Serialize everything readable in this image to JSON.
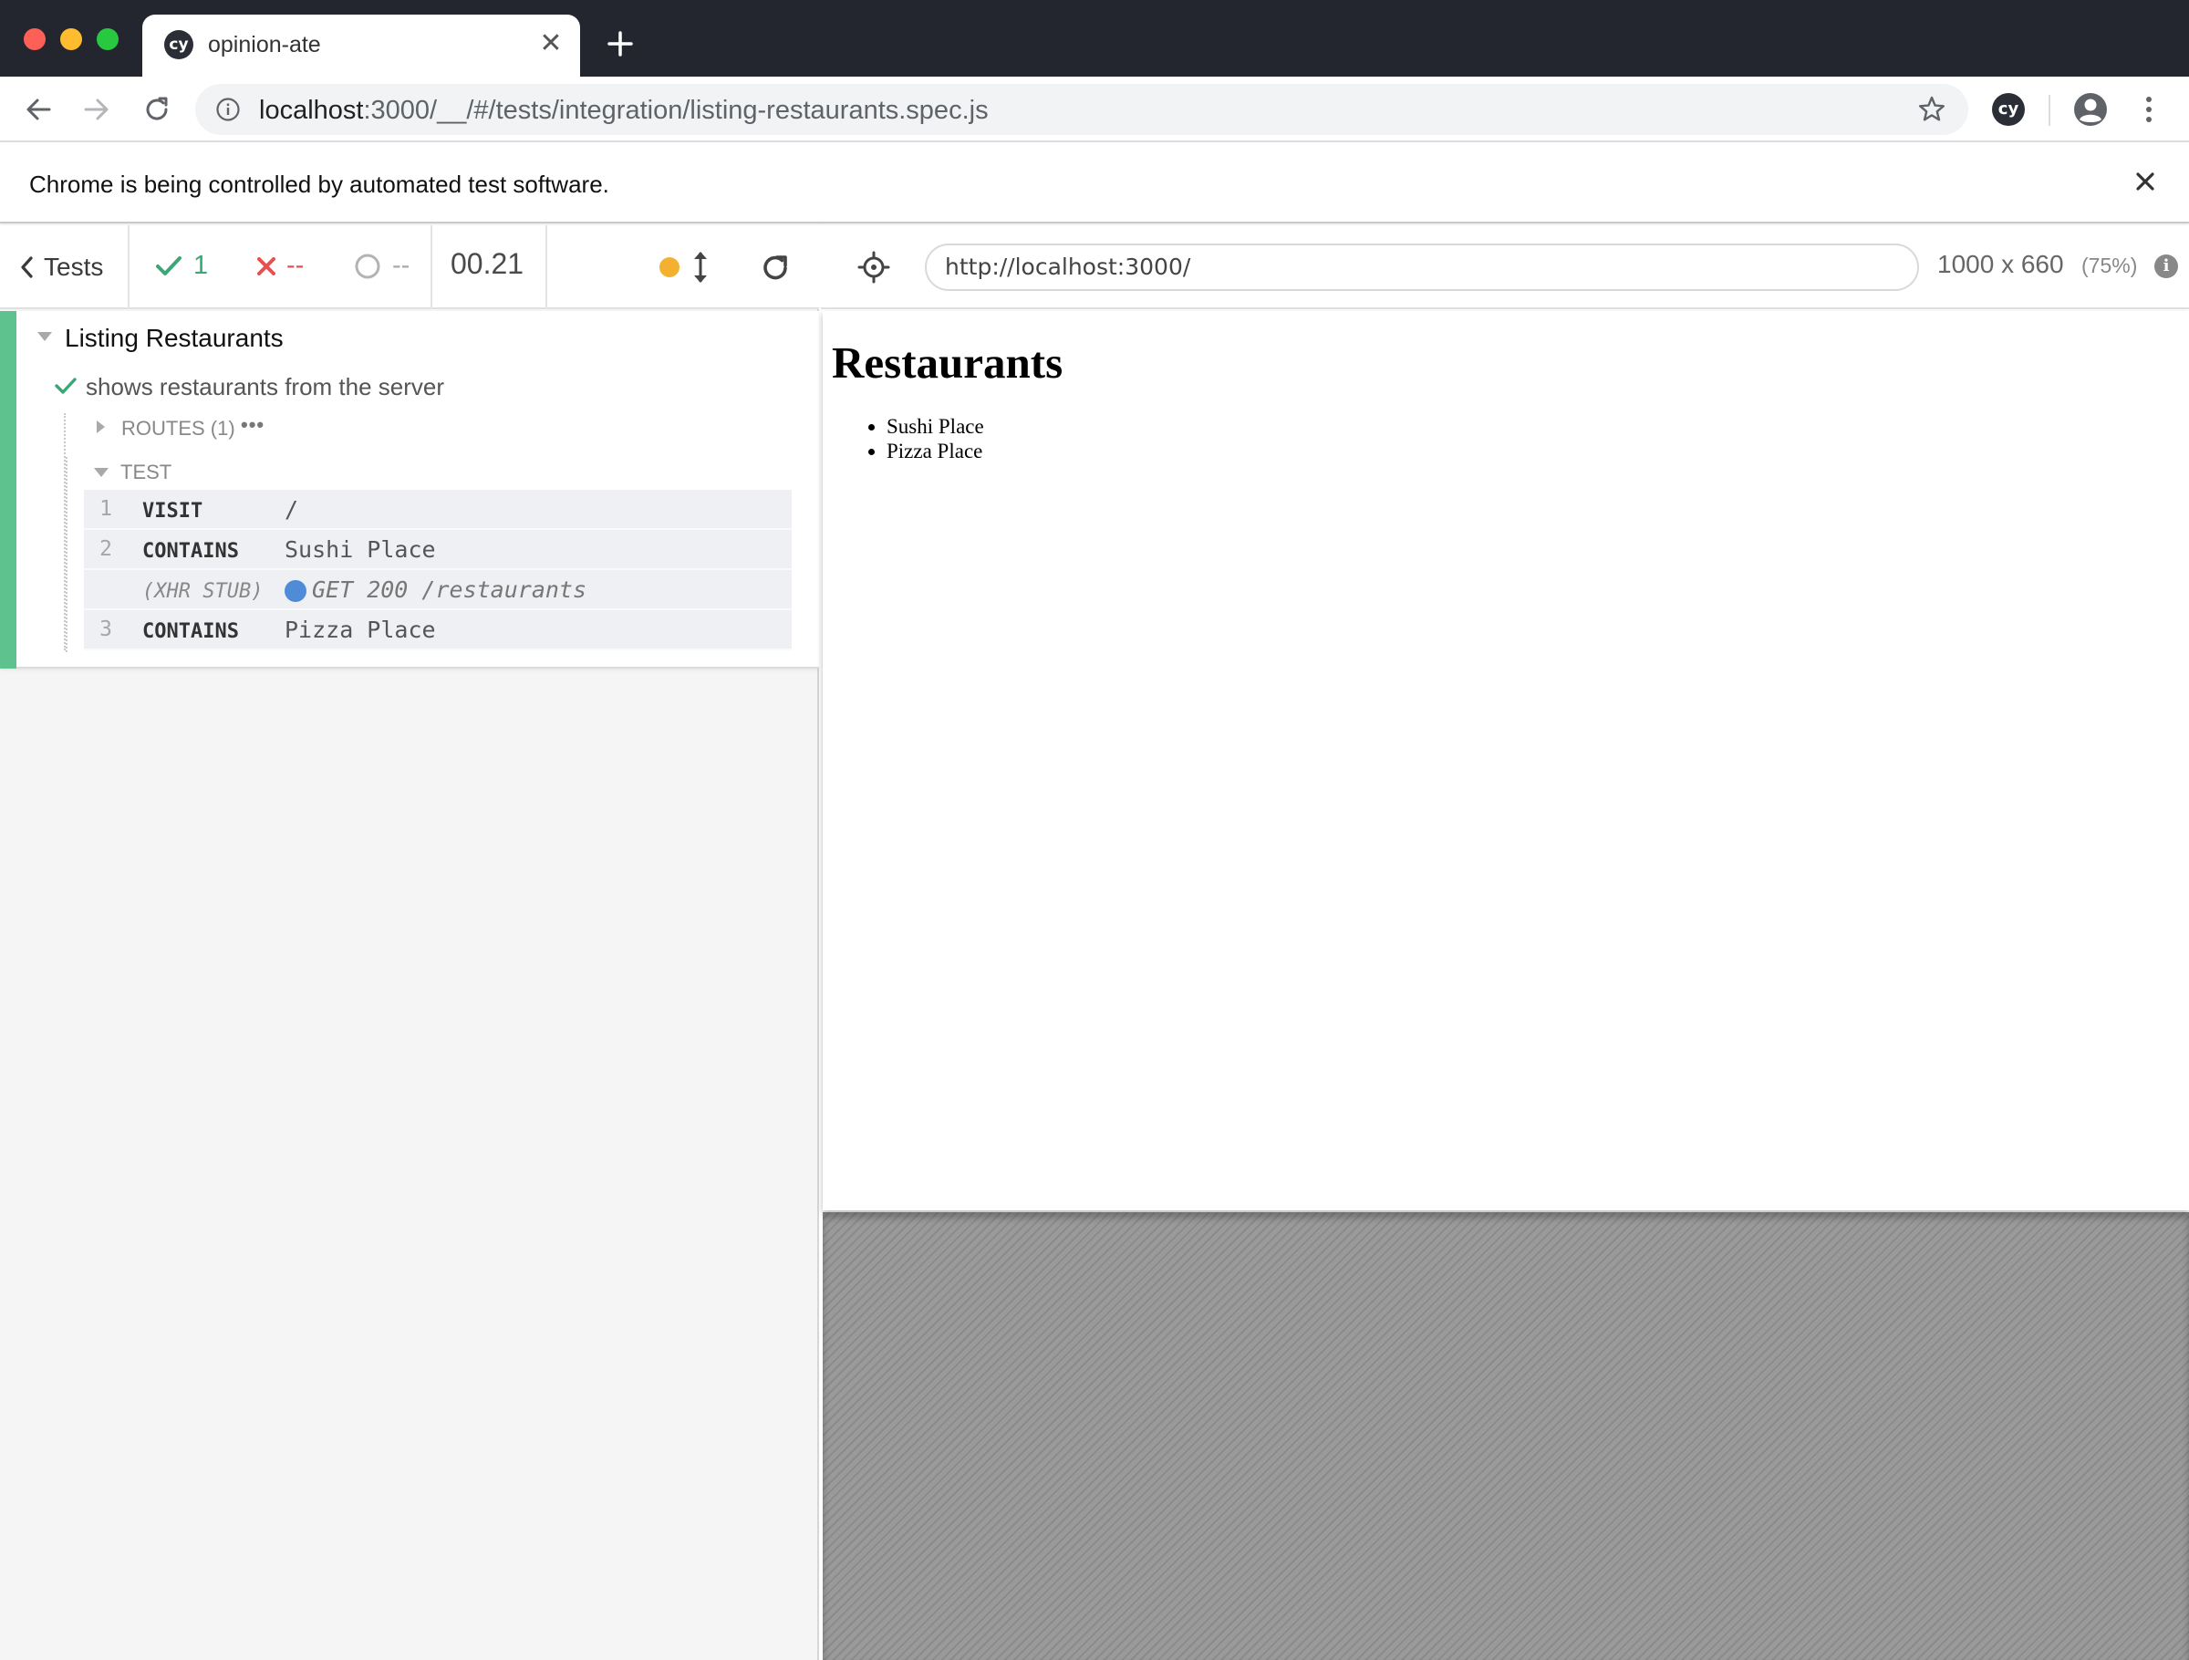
{
  "browser": {
    "tab": {
      "favicon": "cy",
      "title": "opinion-ate",
      "close": "✕"
    },
    "address": {
      "host": "localhost",
      "rest": ":3000/__/#/tests/integration/listing-restaurants.spec.js"
    },
    "extension_label": "cy",
    "icons": [
      "back-arrow-icon",
      "forward-arrow-icon",
      "reload-icon",
      "info-icon",
      "star-icon",
      "profile-icon",
      "menu-dots-icon",
      "new-tab-icon"
    ]
  },
  "infobar": {
    "text": "Chrome is being controlled by automated test software."
  },
  "reporter": {
    "header": {
      "tests_label": "Tests",
      "passed": "1",
      "failed": "--",
      "pending": "--",
      "duration": "00.21"
    },
    "suite": {
      "title": "Listing Restaurants",
      "test": {
        "title": "shows restaurants from the server",
        "routes_label": "ROUTES (1)",
        "routes_more": "•••",
        "test_label": "TEST",
        "commands": [
          {
            "num": "1",
            "name": "VISIT",
            "message": "/"
          },
          {
            "num": "2",
            "name": "CONTAINS",
            "message": "Sushi Place"
          },
          {
            "num": "",
            "name": "(XHR STUB)",
            "message": "GET 200 /restaurants"
          },
          {
            "num": "3",
            "name": "CONTAINS",
            "message": "Pizza Place"
          }
        ]
      }
    },
    "colors": {
      "passed": "#3ba776",
      "failed": "#e94f4f",
      "running": "#f4b12f",
      "xhr": "#4f8bd6"
    }
  },
  "aut": {
    "url": "http://localhost:3000/",
    "viewport_size": "1000 x 660",
    "viewport_scale": "(75%)",
    "info_glyph": "i",
    "page": {
      "heading": "Restaurants",
      "items": [
        "Sushi Place",
        "Pizza Place"
      ]
    }
  }
}
